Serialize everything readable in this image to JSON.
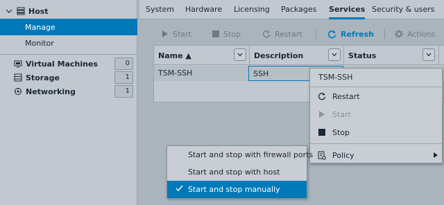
{
  "sidebar": {
    "host_label": "Host",
    "manage_label": "Manage",
    "monitor_label": "Monitor",
    "items": [
      {
        "label": "Virtual Machines",
        "count": "0",
        "icon": "vm-icon"
      },
      {
        "label": "Storage",
        "count": "1",
        "icon": "storage-icon"
      },
      {
        "label": "Networking",
        "count": "1",
        "icon": "network-icon"
      }
    ]
  },
  "tabs": [
    "System",
    "Hardware",
    "Licensing",
    "Packages",
    "Services",
    "Security & users"
  ],
  "active_tab": "Services",
  "toolbar": {
    "start": "Start",
    "stop": "Stop",
    "restart": "Restart",
    "refresh": "Refresh",
    "actions": "Actions"
  },
  "grid": {
    "columns": [
      "Name ▲",
      "Description",
      "Status"
    ],
    "rows": [
      {
        "name": "TSM-SSH",
        "description": "SSH"
      }
    ]
  },
  "context_menu": {
    "title": "TSM-SSH",
    "items": [
      {
        "label": "Restart",
        "enabled": true
      },
      {
        "label": "Start",
        "enabled": false
      },
      {
        "label": "Stop",
        "enabled": true
      },
      {
        "label": "Policy",
        "enabled": true
      }
    ]
  },
  "policy_submenu": {
    "items": [
      {
        "label": "Start and stop with firewall ports",
        "selected": false
      },
      {
        "label": "Start and stop with host",
        "selected": false
      },
      {
        "label": "Start and stop manually",
        "selected": true
      }
    ]
  },
  "colors": {
    "accent": "#0079b8",
    "panel": "#c1c8cf",
    "background": "#aab4bd"
  }
}
